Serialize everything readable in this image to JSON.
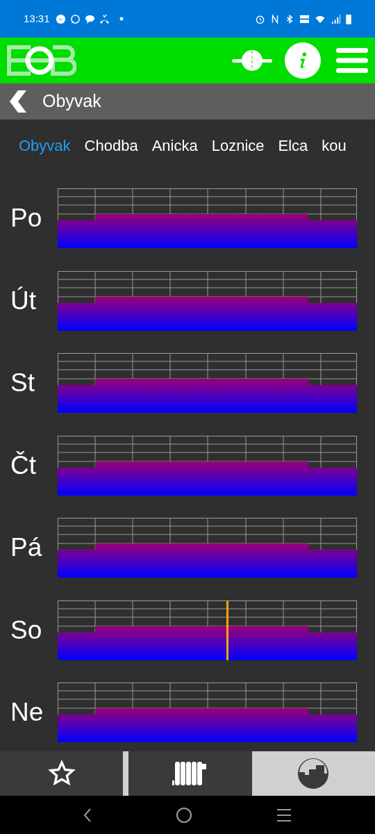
{
  "status_bar": {
    "time": "13:31"
  },
  "header": {
    "title": "Obyvak"
  },
  "rooms": [
    {
      "label": "Obyvak",
      "selected": true
    },
    {
      "label": "Chodba",
      "selected": false
    },
    {
      "label": "Anicka",
      "selected": false
    },
    {
      "label": "Loznice",
      "selected": false
    },
    {
      "label": "Elca",
      "selected": false
    },
    {
      "label": "kou",
      "selected": false
    }
  ],
  "days": [
    {
      "label": "Po",
      "current": false
    },
    {
      "label": "Út",
      "current": false
    },
    {
      "label": "St",
      "current": false
    },
    {
      "label": "Čt",
      "current": false
    },
    {
      "label": "Pá",
      "current": false
    },
    {
      "label": "So",
      "current": true
    },
    {
      "label": "Ne",
      "current": false
    }
  ],
  "bottom_nav": [
    {
      "kind": "favorites",
      "selected": false
    },
    {
      "kind": "heating",
      "selected": false
    },
    {
      "kind": "schedule",
      "selected": true
    }
  ]
}
